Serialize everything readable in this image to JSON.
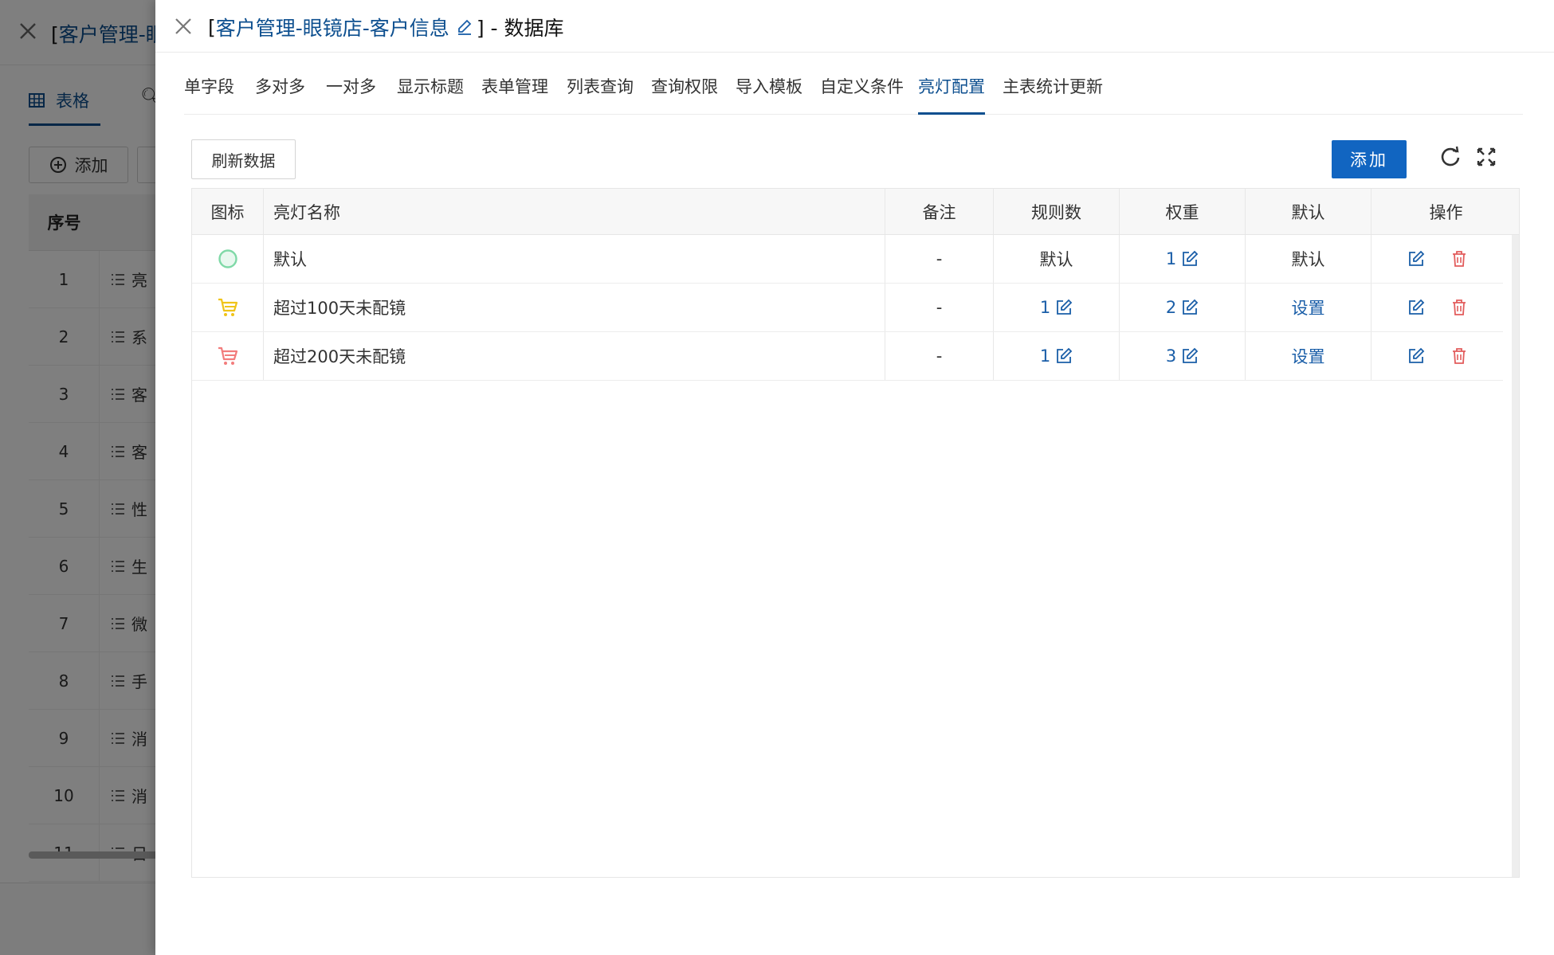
{
  "background": {
    "title_prefix": "[",
    "title_link": "客户管理-眼",
    "tab_table_label": "表格",
    "add_label": "添加",
    "col_index_header": "序号",
    "rows": [
      {
        "index": "1",
        "text": "亮"
      },
      {
        "index": "2",
        "text": "系"
      },
      {
        "index": "3",
        "text": "客"
      },
      {
        "index": "4",
        "text": "客"
      },
      {
        "index": "5",
        "text": "性"
      },
      {
        "index": "6",
        "text": "生"
      },
      {
        "index": "7",
        "text": "微"
      },
      {
        "index": "8",
        "text": "手"
      },
      {
        "index": "9",
        "text": "消"
      },
      {
        "index": "10",
        "text": "消"
      },
      {
        "index": "11",
        "text": "日"
      }
    ]
  },
  "drawer": {
    "title_open": "[",
    "title_link": "客户管理-眼镜店-客户信息",
    "title_close": "] - 数据库",
    "tabs": [
      {
        "label": "单字段"
      },
      {
        "label": "多对多"
      },
      {
        "label": "一对多"
      },
      {
        "label": "显示标题"
      },
      {
        "label": "表单管理"
      },
      {
        "label": "列表查询"
      },
      {
        "label": "查询权限"
      },
      {
        "label": "导入模板"
      },
      {
        "label": "自定义条件"
      },
      {
        "label": "亮灯配置"
      },
      {
        "label": "主表统计更新"
      }
    ],
    "active_tab": "亮灯配置",
    "refresh_label": "刷新数据",
    "add_label": "添加",
    "columns": {
      "icon": "图标",
      "name": "亮灯名称",
      "remark": "备注",
      "rules": "规则数",
      "weight": "权重",
      "default": "默认",
      "ops": "操作"
    },
    "rows": [
      {
        "icon": "circle-icon",
        "icon_color": "#7fd9a7",
        "name": "默认",
        "remark": "-",
        "rules": "默认",
        "rules_editable": false,
        "weight": "1",
        "default": "默认",
        "default_is_link": false
      },
      {
        "icon": "cart-icon",
        "icon_color": "#f0c419",
        "name": "超过100天未配镜",
        "remark": "-",
        "rules": "1",
        "rules_editable": true,
        "weight": "2",
        "default": "设置",
        "default_is_link": true
      },
      {
        "icon": "cart-icon",
        "icon_color": "#f27c7c",
        "name": "超过200天未配镜",
        "remark": "-",
        "rules": "1",
        "rules_editable": true,
        "weight": "3",
        "default": "设置",
        "default_is_link": true
      }
    ],
    "colors": {
      "primary": "#1165c1",
      "link": "#1a5ea8",
      "danger": "#e25c5c"
    }
  }
}
